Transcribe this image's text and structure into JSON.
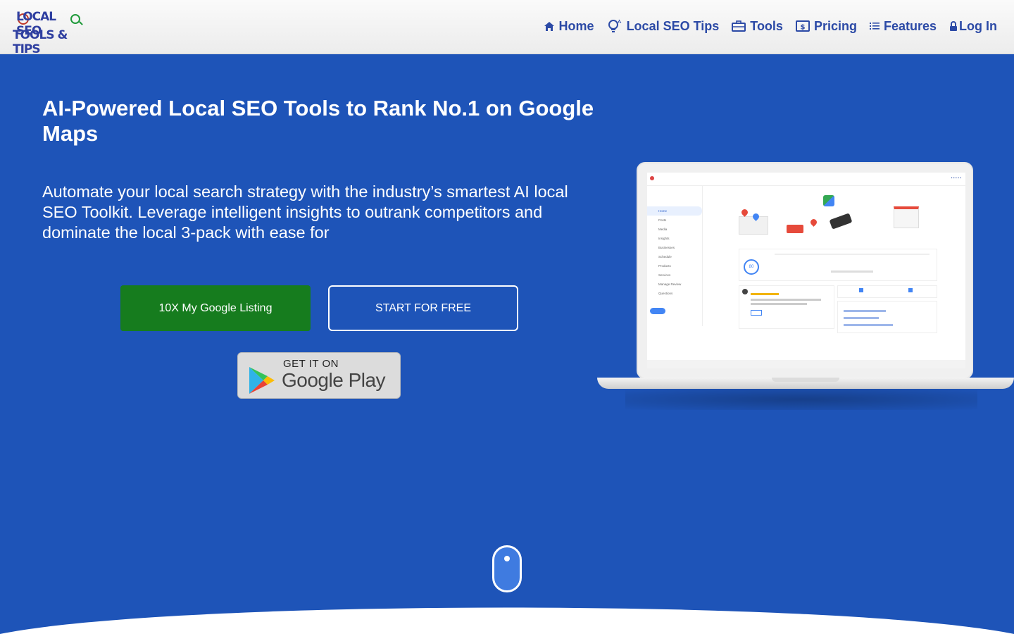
{
  "header": {
    "logo_line1": "LOCAL SEO",
    "logo_line2": "TOOLS & TIPS",
    "nav": [
      {
        "label": "Home",
        "icon": "home-icon"
      },
      {
        "label": "Local SEO Tips",
        "icon": "lightbulb-icon"
      },
      {
        "label": "Tools",
        "icon": "toolbox-icon"
      },
      {
        "label": "Pricing",
        "icon": "dollar-bill-icon"
      },
      {
        "label": "Features",
        "icon": "list-icon"
      },
      {
        "label": "Log In",
        "icon": "lock-icon"
      }
    ]
  },
  "hero": {
    "title": "AI-Powered Local SEO Tools to Rank No.1 on Google Maps",
    "subtitle": "Automate your local search strategy with the industry’s smartest AI local SEO Toolkit. Leverage intelligent insights to outrank competitors and dominate the local 3-pack with ease for",
    "primary_button": "10X My Google Listing",
    "secondary_button": "START FOR FREE",
    "store_badge": {
      "line1": "GET IT ON",
      "line2": "Google Play"
    }
  },
  "laptop_preview": {
    "sidebar_items": [
      "Home",
      "Posts",
      "Media",
      "Insights",
      "Businesses",
      "Schedule",
      "Products",
      "Services",
      "Manage Review",
      "Questions"
    ],
    "health_score": "80"
  },
  "colors": {
    "hero_bg": "#1e54b8",
    "nav_text": "#2c4aa6",
    "primary_button": "#167c1e"
  }
}
